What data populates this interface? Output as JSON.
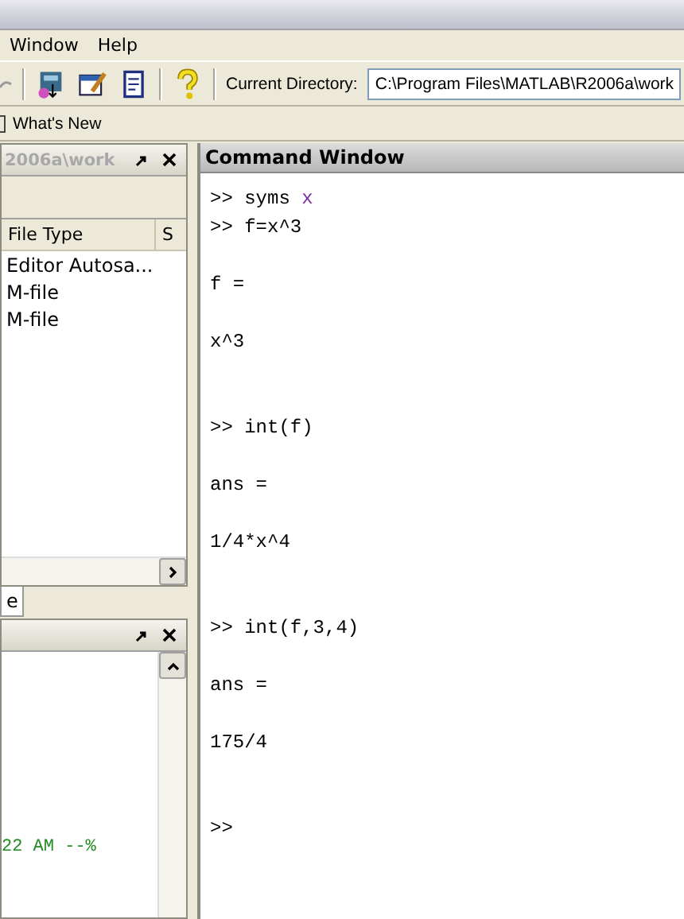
{
  "menu": [
    {
      "label": "Window"
    },
    {
      "label": "Help"
    }
  ],
  "toolbar": {
    "directory_label": "Current Directory:",
    "directory": "C:\\Program Files\\MATLAB\\R2006a\\work"
  },
  "shortcuts": [
    {
      "label": "What's New"
    }
  ],
  "file_panel": {
    "title": "2006a\\work",
    "columns": [
      "File Type",
      "S"
    ],
    "rows": [
      "Editor Autosa...",
      "M-file",
      "M-file"
    ],
    "tabs": [
      {
        "label": "e",
        "selected": true
      }
    ]
  },
  "history_panel": {
    "lines": [
      "22 AM --%"
    ]
  },
  "command_window": {
    "title": "Command Window",
    "lines": [
      {
        "kind": "command",
        "text": ">> syms",
        "symbol": "x"
      },
      {
        "kind": "command",
        "text": ">> f=x^3"
      },
      {
        "kind": "label",
        "text": "f ="
      },
      {
        "kind": "value",
        "text": "x^3"
      },
      {
        "kind": "command",
        "text": ">> int(f)"
      },
      {
        "kind": "label",
        "text": "ans ="
      },
      {
        "kind": "value",
        "text": "1/4*x^4"
      },
      {
        "kind": "command",
        "text": ">> int(f,3,4)"
      },
      {
        "kind": "label",
        "text": "ans ="
      },
      {
        "kind": "value",
        "text": "175/4"
      },
      {
        "kind": "prompt",
        "text": ">>"
      }
    ]
  }
}
